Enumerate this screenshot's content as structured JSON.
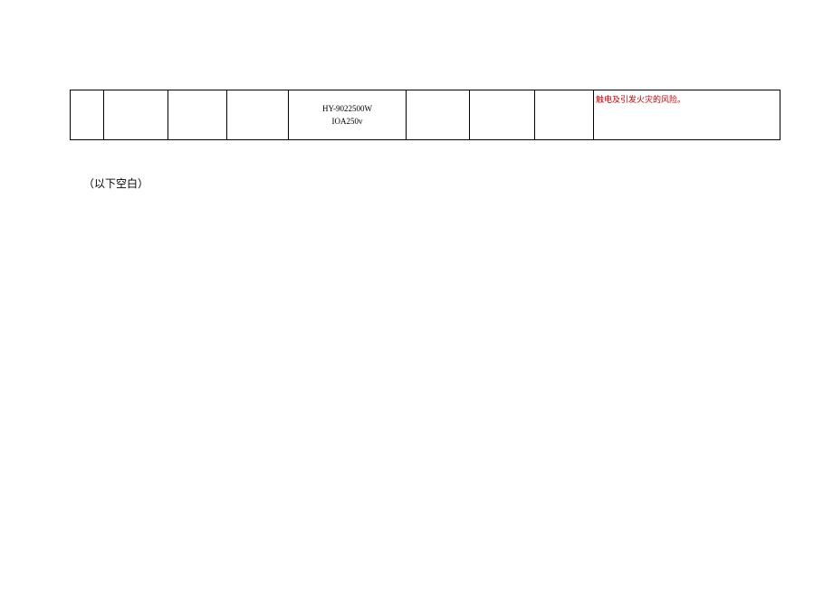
{
  "table": {
    "row": {
      "col1": "",
      "col2": "",
      "col3": "",
      "col4": "",
      "col5_line1": "HY-9022500W",
      "col5_line2": "IOA250v",
      "col6": "",
      "col7": "",
      "col8": "",
      "col9": "触电及引发火灾的风险。"
    }
  },
  "blank_note": "（以下空白）"
}
